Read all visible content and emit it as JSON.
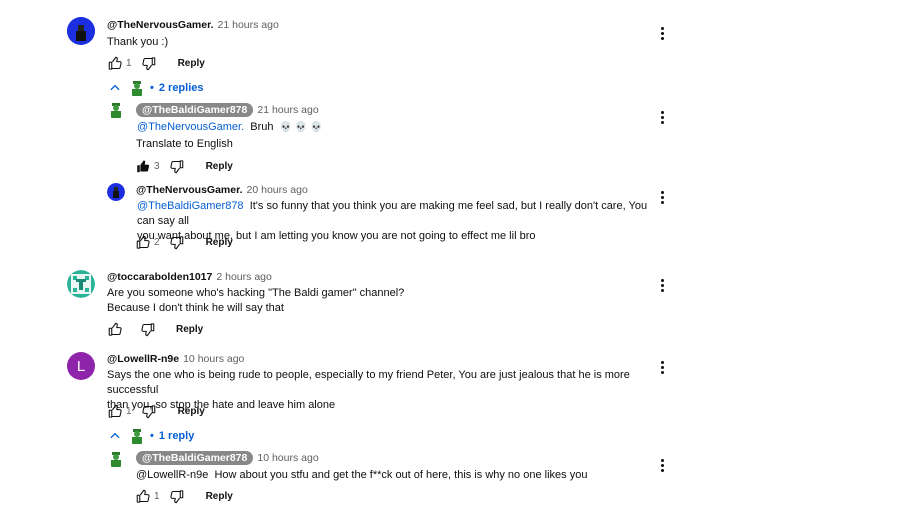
{
  "colors": {
    "link": "#065fd4",
    "meta": "#606060",
    "text": "#0f0f0f",
    "chip": "#888888"
  },
  "icons": {
    "like": "thumb-up-icon",
    "like_filled": "thumb-up-filled-icon",
    "dislike": "thumb-down-icon",
    "more": "more-vert-icon",
    "chevron": "chevron-up-icon",
    "skull": "skull-emoji"
  },
  "reply_label": "Reply",
  "comments": [
    {
      "author": "@TheNervousGamer.",
      "time": "21 hours ago",
      "text": "Thank you :)",
      "likes": "1",
      "replies_toggle": "2 replies",
      "replies": [
        {
          "author": "@TheBaldiGamer878",
          "time": "21 hours ago",
          "mention": "@TheNervousGamer.",
          "text": "Bruh",
          "emoji": "💀 💀 💀",
          "translate": "Translate to English",
          "likes": "3"
        },
        {
          "author": "@TheNervousGamer.",
          "time": "20 hours ago",
          "mention": "@TheBaldiGamer878",
          "text_line1": "It's so funny that you think you are making me feel sad, but I really don't care, You can say all",
          "text_line2": "you want about me, but I am letting you know you are not going to effect me lil bro",
          "likes": "2"
        }
      ]
    },
    {
      "author": "@toccarabolden1017",
      "time": "2 hours ago",
      "text_line1": "Are you someone who's hacking \"The Baldi gamer\" channel?",
      "text_line2": "Because I don't think he will say that",
      "likes": ""
    },
    {
      "author": "@LowellR-n9e",
      "time": "10 hours ago",
      "avatar_letter": "L",
      "text_line1": "Says the one who is being rude to people, especially to my friend Peter, You are just jealous that he is more successful",
      "text_line2": "than you, so stop the hate and leave him alone",
      "likes": "1",
      "replies_toggle": "1 reply",
      "replies": [
        {
          "author": "@TheBaldiGamer878",
          "time": "10 hours ago",
          "mention": "@LowellR-n9e",
          "text": "How about you stfu and get the f**ck out of here, this is why no one likes you",
          "likes": "1"
        }
      ]
    }
  ]
}
